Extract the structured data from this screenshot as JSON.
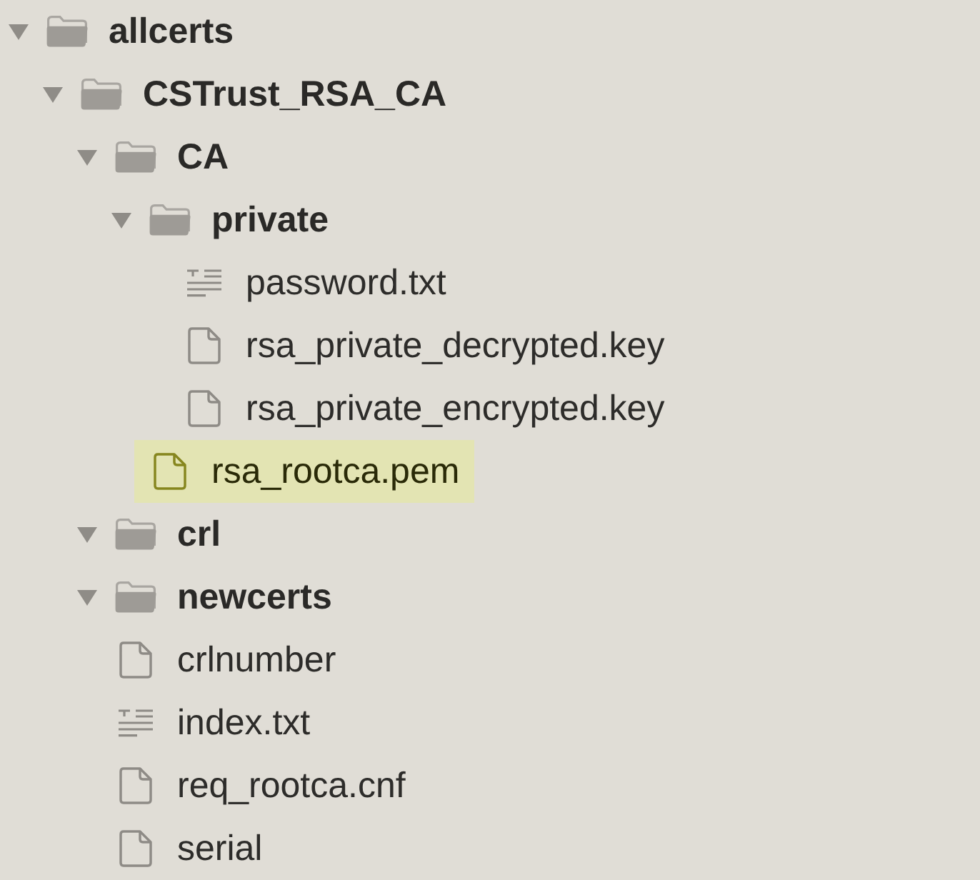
{
  "tree": [
    {
      "kind": "folder",
      "name": "allcerts",
      "expanded": true,
      "selected": false,
      "children": [
        {
          "kind": "folder",
          "name": "CSTrust_RSA_CA",
          "expanded": true,
          "selected": false,
          "children": [
            {
              "kind": "folder",
              "name": "CA",
              "expanded": true,
              "selected": false,
              "children": [
                {
                  "kind": "folder",
                  "name": "private",
                  "expanded": true,
                  "selected": false,
                  "children": [
                    {
                      "kind": "text",
                      "name": "password.txt",
                      "selected": false
                    },
                    {
                      "kind": "file",
                      "name": "rsa_private_decrypted.key",
                      "selected": false
                    },
                    {
                      "kind": "file",
                      "name": "rsa_private_encrypted.key",
                      "selected": false
                    }
                  ]
                },
                {
                  "kind": "file",
                  "name": "rsa_rootca.pem",
                  "selected": true
                }
              ]
            },
            {
              "kind": "folder",
              "name": "crl",
              "expanded": true,
              "selected": false
            },
            {
              "kind": "folder",
              "name": "newcerts",
              "expanded": true,
              "selected": false
            },
            {
              "kind": "file",
              "name": "crlnumber",
              "selected": false
            },
            {
              "kind": "text",
              "name": "index.txt",
              "selected": false
            },
            {
              "kind": "file",
              "name": "req_rootca.cnf",
              "selected": false
            },
            {
              "kind": "file",
              "name": "serial",
              "selected": false
            }
          ]
        }
      ]
    }
  ]
}
